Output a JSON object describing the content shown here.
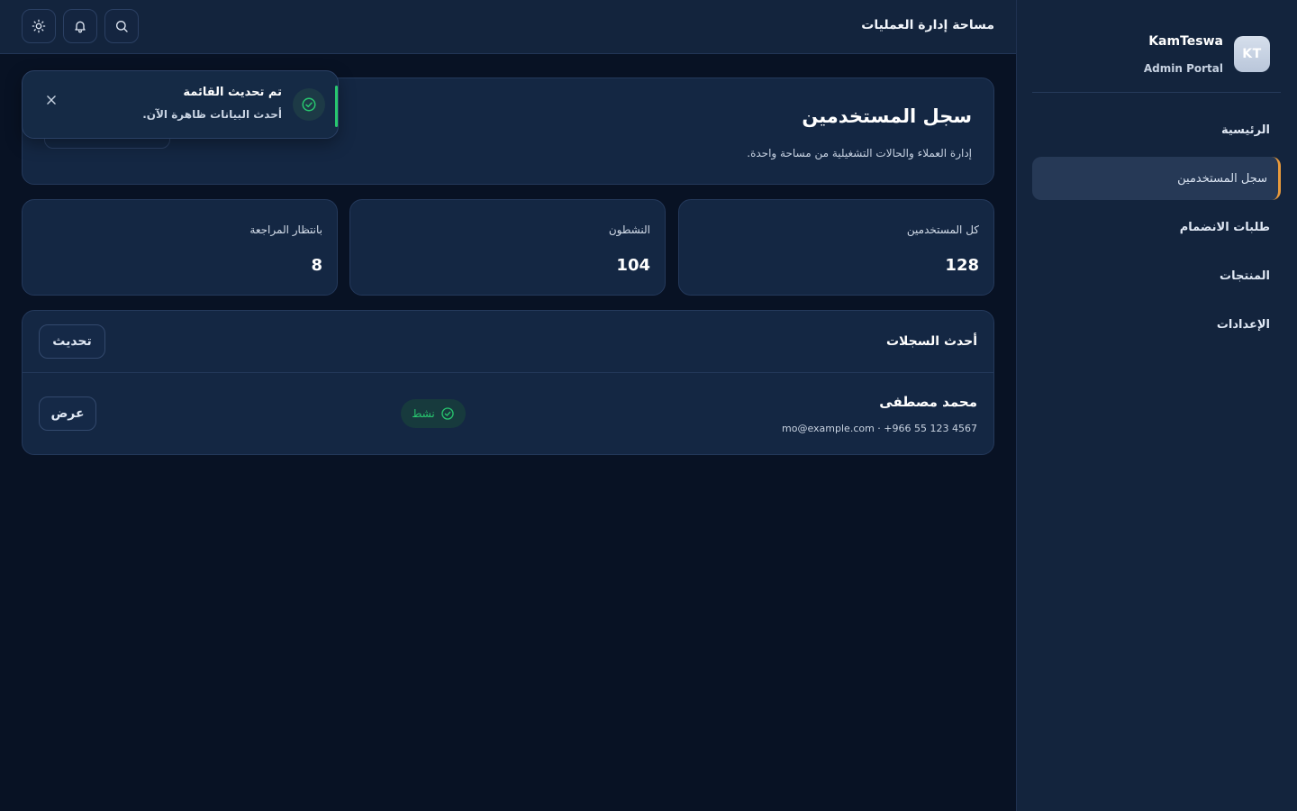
{
  "sidebar": {
    "brand_initials": "KT",
    "brand_name": "KamTeswa",
    "brand_subtitle": "Admin Portal",
    "items": [
      {
        "label": "الرئيسية",
        "active": false
      },
      {
        "label": "سجل المستخدمين",
        "active": true
      },
      {
        "label": "طلبات الانضمام",
        "active": false
      },
      {
        "label": "المنتجات",
        "active": false
      },
      {
        "label": "الإعدادات",
        "active": false
      }
    ]
  },
  "topbar": {
    "title": "مساحة إدارة العمليات",
    "icons": [
      "search-icon",
      "bell-icon",
      "sun-icon"
    ]
  },
  "hero": {
    "title": "سجل المستخدمين",
    "subtitle": "إدارة العملاء والحالات التشغيلية من مساحة واحدة."
  },
  "stats": [
    {
      "label": "كل المستخدمين",
      "value": "128"
    },
    {
      "label": "النشطون",
      "value": "104"
    },
    {
      "label": "بانتظار المراجعة",
      "value": "8"
    }
  ],
  "records": {
    "title": "أحدث السجلات",
    "refresh_label": "تحديث",
    "rows": [
      {
        "name": "محمد مصطفى",
        "meta": "mo@example.com · +966 55 123 4567",
        "status": "نشط",
        "action": "عرض"
      }
    ]
  },
  "toast": {
    "title": "تم تحديث القائمة",
    "message": "أحدث البيانات ظاهرة الآن."
  },
  "colors": {
    "accent": "#e89a3c",
    "success": "#28c76f",
    "background": "#081224",
    "surface": "#142743"
  }
}
